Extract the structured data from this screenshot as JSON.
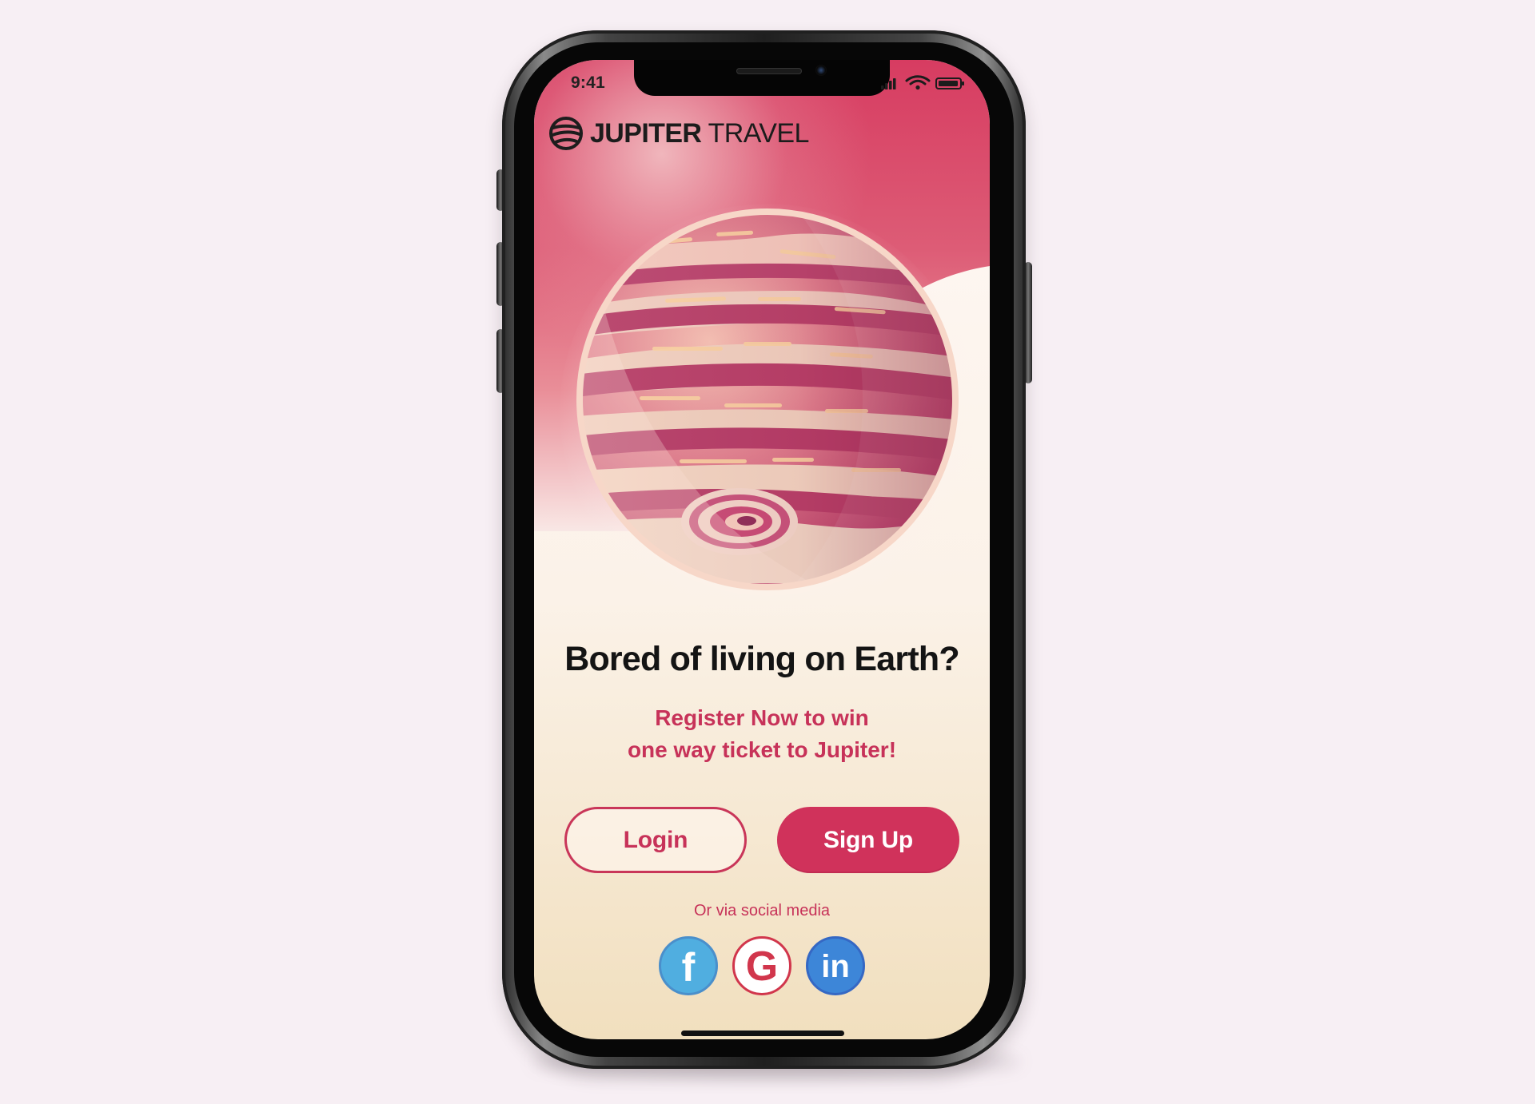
{
  "scene": {
    "background": "#f7eff4"
  },
  "device": {
    "model": "iPhone X style frame",
    "frame_color": "#2b2b2b"
  },
  "status_bar": {
    "time": "9:41",
    "icons": [
      "signal-icon",
      "wifi-icon",
      "battery-icon"
    ]
  },
  "brand": {
    "name_bold": "JUPITER",
    "name_light": " TRAVEL",
    "logo_icon": "jupiter-logo-icon"
  },
  "hero": {
    "illustration": "jupiter-planet-illustration",
    "headline": "Bored of living on Earth?",
    "subline_1": "Register Now to win",
    "subline_2": "one way ticket to Jupiter!"
  },
  "actions": {
    "login_label": "Login",
    "signup_label": "Sign Up"
  },
  "social": {
    "caption": "Or via social media",
    "providers": [
      {
        "name": "Facebook",
        "icon": "facebook-icon",
        "glyph": "f",
        "color": "#50aee0"
      },
      {
        "name": "Google",
        "icon": "google-icon",
        "glyph": "G",
        "color": "#d1364c"
      },
      {
        "name": "LinkedIn",
        "icon": "linkedin-icon",
        "glyph": "in",
        "color": "#3d86d8"
      }
    ]
  },
  "theme": {
    "primary": "#d0325b",
    "text_accent": "#c73259",
    "headline_color": "#141414",
    "cream": "#f1dfbe"
  }
}
